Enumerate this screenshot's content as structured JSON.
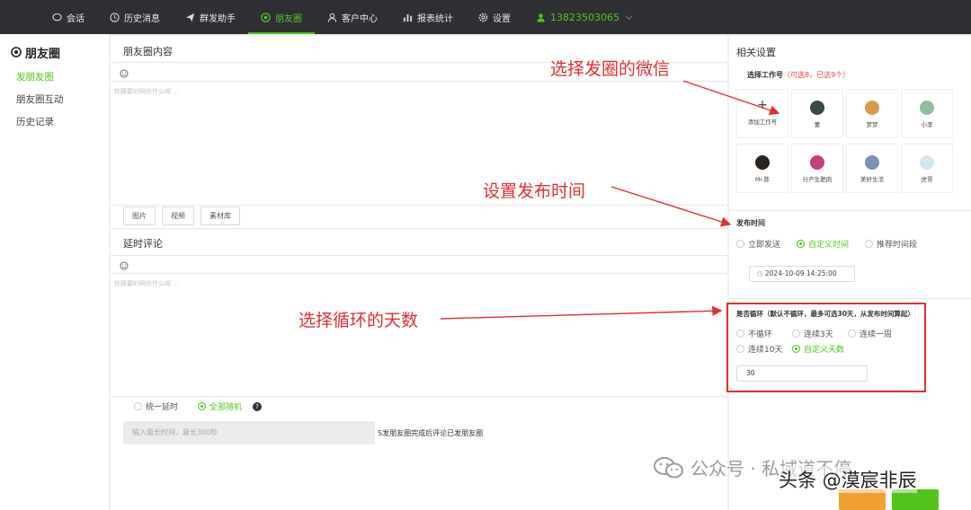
{
  "nav": {
    "items": [
      {
        "label": "会话",
        "icon": "chat-icon"
      },
      {
        "label": "历史消息",
        "icon": "clock-icon"
      },
      {
        "label": "群发助手",
        "icon": "send-icon"
      },
      {
        "label": "朋友圈",
        "icon": "moments-icon",
        "active": true
      },
      {
        "label": "客户中心",
        "icon": "user-icon"
      },
      {
        "label": "报表统计",
        "icon": "bar-chart-icon"
      },
      {
        "label": "设置",
        "icon": "gear-icon"
      }
    ],
    "user_phone": "13823503065"
  },
  "sidebar": {
    "title": "朋友圈",
    "items": [
      {
        "label": "发朋友圈",
        "active": true
      },
      {
        "label": "朋友圈互动"
      },
      {
        "label": "历史记录"
      }
    ]
  },
  "main": {
    "content_title": "朋友圈内容",
    "content_placeholder": "你那要的啊你什么呢 ...",
    "media_buttons": [
      "图片",
      "视频",
      "素材库"
    ],
    "comment_title": "延时评论",
    "comment_placeholder": "你那要的啊你什么呢 ...",
    "delay_options": [
      {
        "label": "统一延时",
        "selected": false
      },
      {
        "label": "全部随机",
        "selected": true
      }
    ],
    "delay_input_placeholder": "输入最长时间，最长300秒",
    "delay_note": "S发朋友圈完成后评论已发朋友圈"
  },
  "right_panel": {
    "title": "相关设置",
    "account_label": "选择工作号",
    "account_hint": "（可选8，已选9个）",
    "accounts": [
      {
        "name": "添加工作号",
        "type": "add"
      },
      {
        "name": "董",
        "color": "#3b4a40"
      },
      {
        "name": "梦梦",
        "color": "#d89a4a"
      },
      {
        "name": "小李",
        "color": "#8fbf9c"
      },
      {
        "name": "Mr.陈",
        "color": "#2a2420"
      },
      {
        "name": "行产生肥肉",
        "color": "#c0407a"
      },
      {
        "name": "美好生活",
        "color": "#7a90b8"
      },
      {
        "name": "虎哥",
        "color": "#d6e6ee"
      }
    ],
    "publish_title": "发布时间",
    "publish_options": [
      {
        "label": "立即发送",
        "selected": false
      },
      {
        "label": "自定义时间",
        "selected": true
      },
      {
        "label": "推荐时间段",
        "selected": false
      }
    ],
    "publish_time": "2024-10-09 14:25:00",
    "loop_title": "是否循环（默认不循环，最多可选30天，从发布时间算起）",
    "loop_options_row1": [
      {
        "label": "不循环",
        "selected": false
      },
      {
        "label": "连续3天",
        "selected": false
      },
      {
        "label": "连续一周",
        "selected": false
      }
    ],
    "loop_options_row2": [
      {
        "label": "连续10天",
        "selected": false
      },
      {
        "label": "自定义天数",
        "selected": true
      }
    ],
    "loop_days": "30"
  },
  "annotations": {
    "select_wechat": "选择发圈的微信",
    "set_time": "设置发布时间",
    "select_days": "选择循环的天数"
  },
  "watermark": {
    "wechat": "公众号 · 私域道不停",
    "toutiao": "头条 @漠宸非辰"
  },
  "colors": {
    "accent": "#52c41a",
    "annotation": "#e03030",
    "topbar": "#2f3033"
  }
}
